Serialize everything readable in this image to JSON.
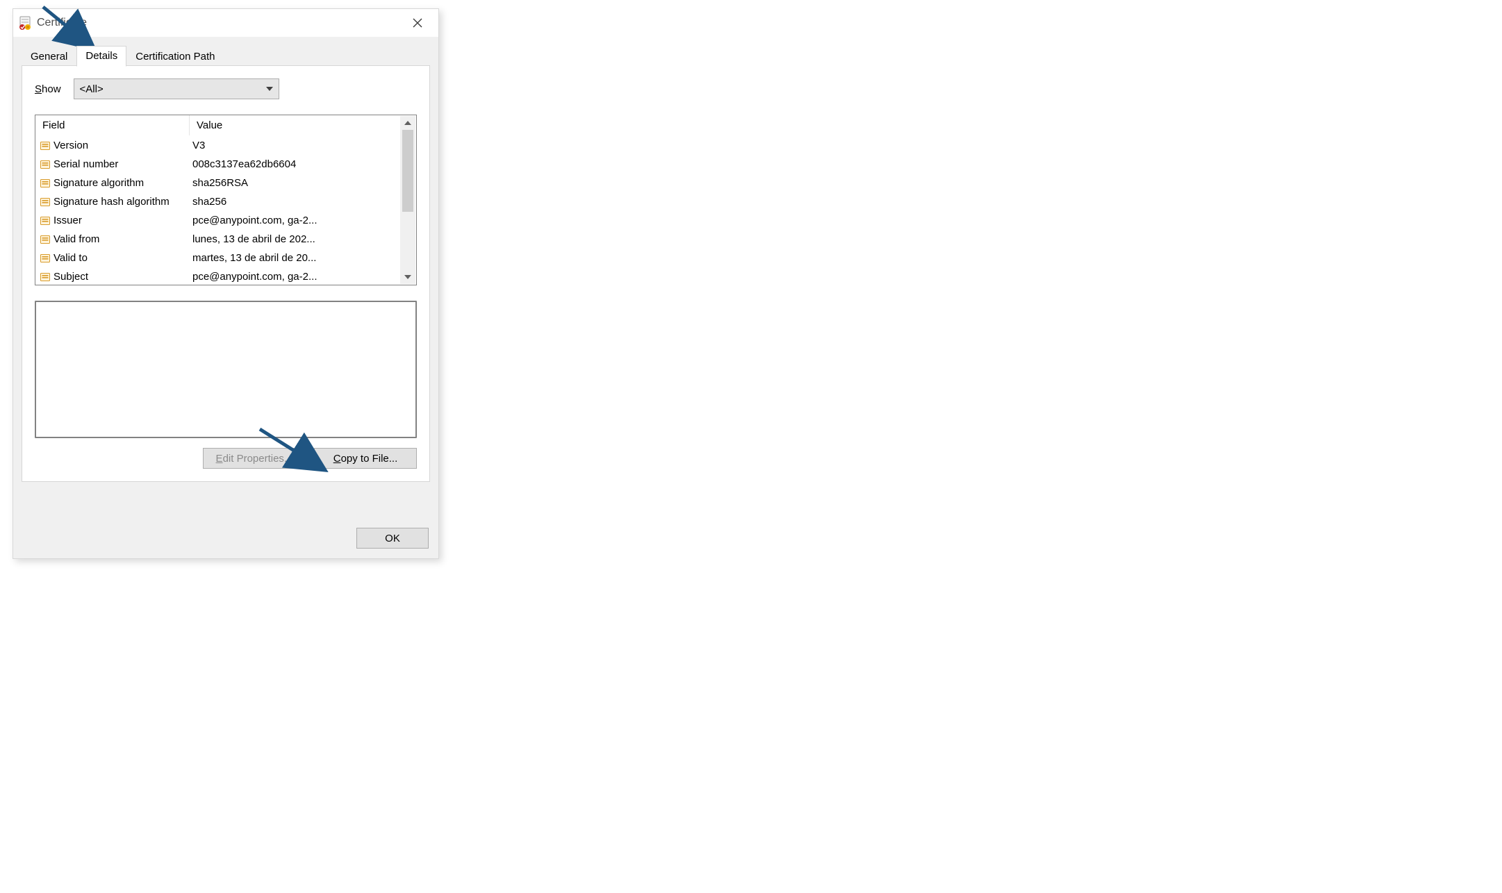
{
  "window": {
    "title": "Certificate"
  },
  "tabs": {
    "general": "General",
    "details": "Details",
    "cert_path": "Certification Path"
  },
  "show": {
    "label_s": "S",
    "label_rest": "how",
    "selected": "<All>"
  },
  "list": {
    "header_field": "Field",
    "header_value": "Value",
    "rows": [
      {
        "field": "Version",
        "value": "V3"
      },
      {
        "field": "Serial number",
        "value": "008c3137ea62db6604"
      },
      {
        "field": "Signature algorithm",
        "value": "sha256RSA"
      },
      {
        "field": "Signature hash algorithm",
        "value": "sha256"
      },
      {
        "field": "Issuer",
        "value": "pce@anypoint.com, ga-2..."
      },
      {
        "field": "Valid from",
        "value": "lunes, 13 de abril de 202..."
      },
      {
        "field": "Valid to",
        "value": "martes, 13 de abril de 20..."
      },
      {
        "field": "Subject",
        "value": "pce@anypoint.com, ga-2..."
      }
    ]
  },
  "buttons": {
    "edit_e": "E",
    "edit_rest": "dit Properties...",
    "copy_c": "C",
    "copy_rest": "opy to File...",
    "ok": "OK"
  }
}
